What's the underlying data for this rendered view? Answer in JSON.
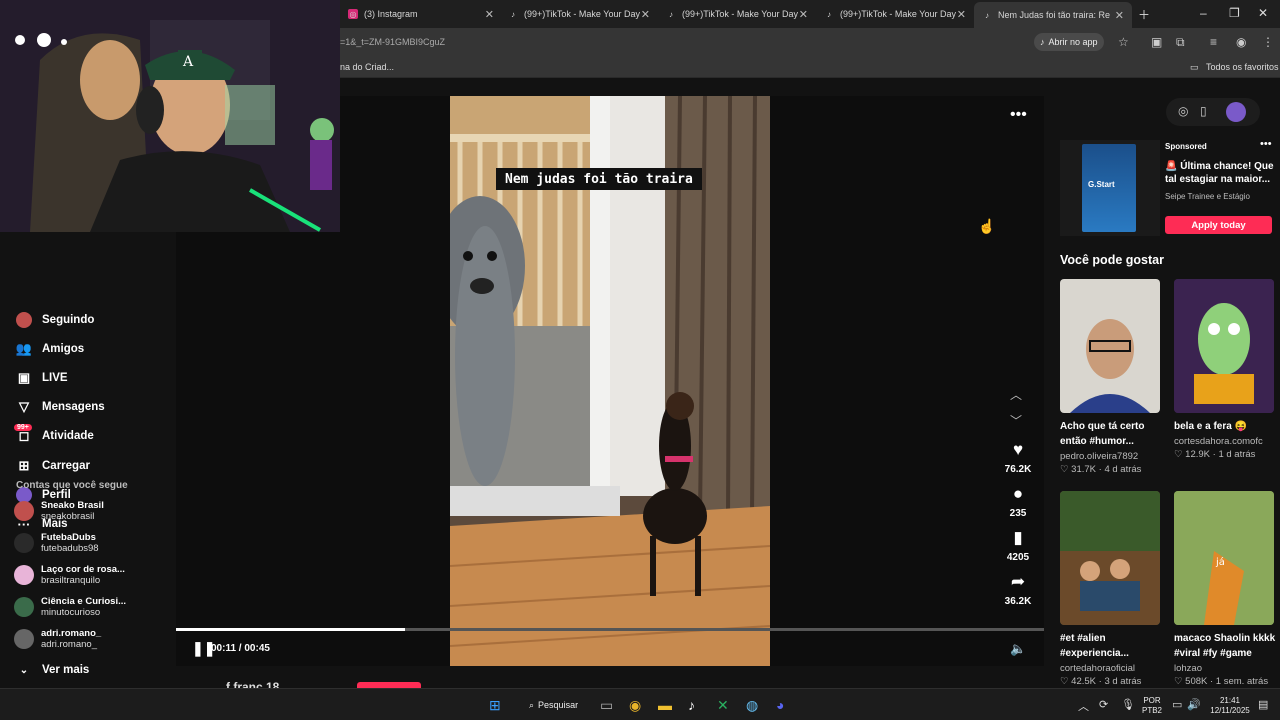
{
  "browser": {
    "tabs": [
      {
        "title": "(3) Instagram",
        "icon": "instagram-icon"
      },
      {
        "title": "(99+)TikTok - Make Your Day",
        "icon": "tiktok-icon"
      },
      {
        "title": "(99+)TikTok - Make Your Day",
        "icon": "tiktok-icon"
      },
      {
        "title": "(99+)TikTok - Make Your Day",
        "icon": "tiktok-icon"
      },
      {
        "title": "Nem Judas foi tão traira: Re",
        "icon": "tiktok-icon"
      }
    ],
    "url": "=1&_t=ZM-91GMBI9CguZ",
    "open_app_label": "Abrir no app",
    "bookmark": "na do Criad...",
    "all_favorites": "Todos os favoritos"
  },
  "sidebar": {
    "items": [
      {
        "label": "Seguindo",
        "icon": "following-avatar-icon"
      },
      {
        "label": "Amigos",
        "icon": "friends-icon"
      },
      {
        "label": "LIVE",
        "icon": "live-icon"
      },
      {
        "label": "Mensagens",
        "icon": "messages-icon"
      },
      {
        "label": "Atividade",
        "icon": "activity-icon",
        "badge": "99+"
      },
      {
        "label": "Carregar",
        "icon": "upload-icon"
      },
      {
        "label": "Perfil",
        "icon": "profile-avatar-icon"
      },
      {
        "label": "Mais",
        "icon": "more-icon"
      }
    ],
    "following_title": "Contas que você segue",
    "accounts": [
      {
        "name": "Sneako Brasil",
        "handle": "sneakobrasil",
        "color": "#c0504d"
      },
      {
        "name": "FutebaDubs",
        "handle": "futebadubs98",
        "color": "#333333"
      },
      {
        "name": "Laço cor de rosa...",
        "handle": "brasiltranquilo",
        "color": "#e8b4d8"
      },
      {
        "name": "Ciência e Curiosi...",
        "handle": "minutocurioso",
        "color": "#3a6b4a"
      },
      {
        "name": "adri.romano_",
        "handle": "adri.romano_",
        "color": "#666666"
      }
    ],
    "see_more": "Ver mais"
  },
  "video": {
    "caption": "Nem judas foi tão traira",
    "likes": "76.2K",
    "comments": "235",
    "saves": "4205",
    "shares": "36.2K",
    "time": "00:11 / 00:45",
    "progress": 0.264,
    "author_partial": "f franc 18"
  },
  "ad": {
    "sponsored": "Sponsored",
    "title": "🚨 Última chance! Que tal estagiar na maior...",
    "subtitle": "Seipe Trainee e Estágio",
    "cta": "Apply today",
    "image_text": "G.Start"
  },
  "recommendations": {
    "title": "Você pode gostar",
    "items": [
      {
        "title": "Acho que tá certo",
        "title2": "então #humor...",
        "author": "pedro.oliveira7892",
        "likes": "31.7K",
        "age": "4 d atrás"
      },
      {
        "title": "bela e a fera 😝",
        "title2": "",
        "author": "cortesdahora.comofc",
        "likes": "12.9K",
        "age": "1 d atrás"
      },
      {
        "title": "#et #alien",
        "title2": "#experiencia...",
        "author": "cortedahoraoficial",
        "likes": "42.5K",
        "age": "3 d atrás"
      },
      {
        "title": "macaco Shaolin kkkk",
        "title2": "#viral #fy #game",
        "author": "lohzao",
        "likes": "508K",
        "age": "1 sem. atrás"
      }
    ]
  },
  "taskbar": {
    "search": "Pesquisar",
    "lang1": "POR",
    "lang2": "PTB2",
    "time": "21:41",
    "date": "12/11/2025"
  }
}
